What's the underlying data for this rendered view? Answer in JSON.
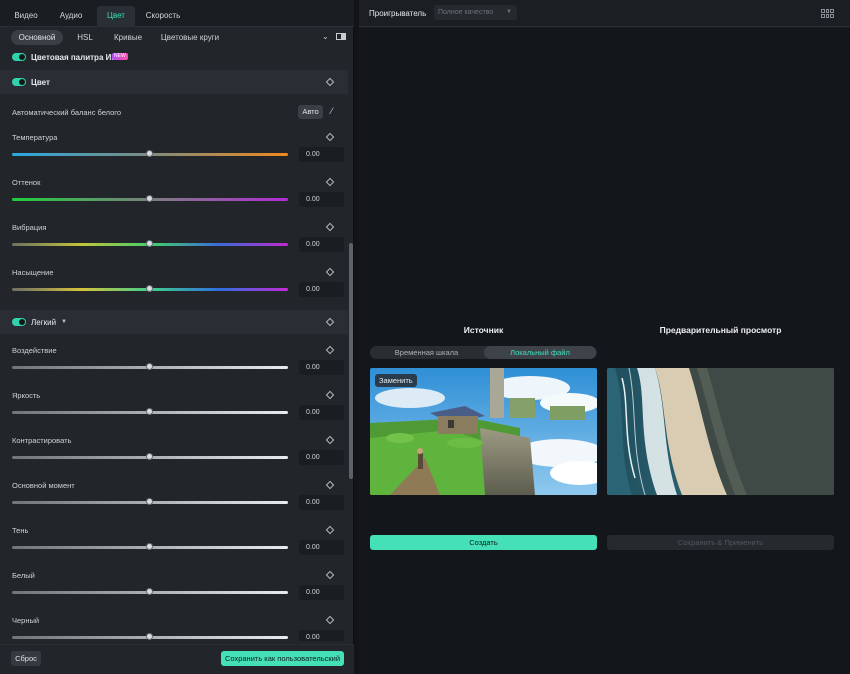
{
  "tabs": [
    "Видео",
    "Аудио",
    "Цвет",
    "Скорость"
  ],
  "active_tab": "Цвет",
  "subtabs": [
    "Основной",
    "HSL",
    "Кривые",
    "Цветовые круги"
  ],
  "active_subtab": "Основной",
  "ai_palette": {
    "label": "Цветовая палитра ИИ",
    "badge": "NEW",
    "enabled": true
  },
  "color_section": {
    "title": "Цвет",
    "enabled": true,
    "white_balance_label": "Автоматический баланс белого",
    "auto_button": "Авто",
    "sliders": [
      {
        "label": "Температура",
        "value": "0.00",
        "level": 0.5
      },
      {
        "label": "Оттенок",
        "value": "0.00",
        "level": 0.5
      },
      {
        "label": "Вибрация",
        "value": "0.00",
        "level": 0.5
      },
      {
        "label": "Насыщение",
        "value": "0.00",
        "level": 0.5
      }
    ]
  },
  "light_section": {
    "title": "Легкий",
    "enabled": true,
    "sliders": [
      {
        "label": "Воздействие",
        "value": "0.00",
        "level": 0.5
      },
      {
        "label": "Яркость",
        "value": "0.00",
        "level": 0.5
      },
      {
        "label": "Контрастировать",
        "value": "0.00",
        "level": 0.5
      },
      {
        "label": "Основной момент",
        "value": "0.00",
        "level": 0.5
      },
      {
        "label": "Тень",
        "value": "0.00",
        "level": 0.5
      },
      {
        "label": "Белый",
        "value": "0.00",
        "level": 0.5
      },
      {
        "label": "Черный",
        "value": "0.00",
        "level": 0.5
      }
    ]
  },
  "footer": {
    "reset": "Сброс",
    "save_custom": "Сохранить как пользовательский"
  },
  "player": {
    "label": "Проигрыватель",
    "quality_placeholder": "Полное качество"
  },
  "compare": {
    "source_title": "Источник",
    "preview_title": "Предварительный просмотр",
    "source_options": [
      "Временная шкала",
      "Локальный файл"
    ],
    "active_source": "Локальный файл",
    "replace_label": "Заменить",
    "create_button": "Создать",
    "save_apply_button": "Сохранить & Применить"
  },
  "colors": {
    "accent": "#45dfb8",
    "panel": "#22262b",
    "canvas": "#13161a"
  }
}
